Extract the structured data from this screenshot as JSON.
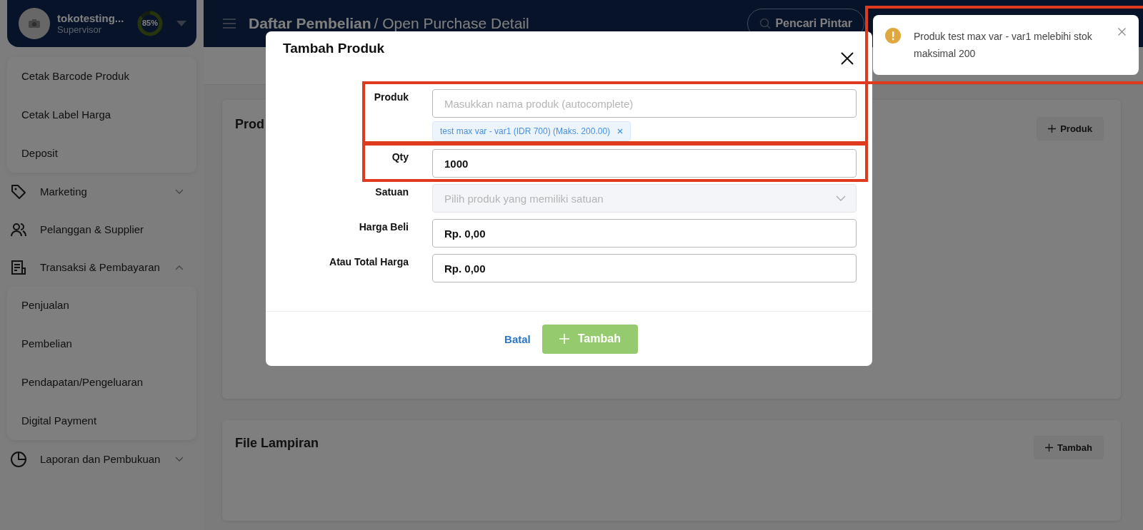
{
  "sidebar": {
    "profile": {
      "name": "tokotesting...",
      "role": "Supervisor",
      "progress_label": "85%",
      "level": 0.85
    },
    "submenu_top": [
      {
        "label": "Cetak Barcode Produk"
      },
      {
        "label": "Cetak Label Harga"
      },
      {
        "label": "Deposit"
      }
    ],
    "items": [
      {
        "label": "Marketing",
        "kind": "tag",
        "expanded": false
      },
      {
        "label": "Pelanggan & Supplier",
        "kind": "users"
      },
      {
        "label": "Transaksi & Pembayaran",
        "kind": "receipt",
        "expanded": true,
        "children": [
          {
            "label": "Penjualan"
          },
          {
            "label": "Pembelian"
          },
          {
            "label": "Pendapatan/Pengeluaran"
          },
          {
            "label": "Digital Payment"
          }
        ]
      },
      {
        "label": "Laporan dan Pembukuan",
        "kind": "pie",
        "expanded": false
      }
    ]
  },
  "header": {
    "title": "Daftar Pembelian",
    "subtitle": "/ Open Purchase Detail",
    "search": "Pencari Pintar"
  },
  "cards": [
    {
      "title": "Prod",
      "button": "Produk"
    },
    {
      "title": "File Lampiran",
      "button": "Tambah"
    }
  ],
  "modal": {
    "title": "Tambah Produk",
    "fields": [
      {
        "label": "Produk",
        "kind": "text",
        "placeholder": "Masukkan nama produk (autocomplete)",
        "tags": [
          "test max var - var1 (IDR 700) (Maks. 200.00)"
        ],
        "highlighted": true
      },
      {
        "label": "Qty",
        "kind": "text",
        "value": "1000",
        "highlighted": true
      },
      {
        "label": "Satuan",
        "kind": "select",
        "placeholder": "Pilih produk yang memiliki satuan",
        "disabled": true,
        "highlighted": false
      },
      {
        "label": "Harga Beli",
        "kind": "text",
        "value": "Rp. 0,00",
        "highlighted": false
      },
      {
        "label": "Atau Total Harga",
        "kind": "text",
        "value": "Rp. 0,00",
        "highlighted": false
      }
    ],
    "cancel": "Batal",
    "submit": "Tambah"
  },
  "toast": {
    "message": "Produk test max var - var1 melebihi stok maksimal 200",
    "highlighted": true
  }
}
